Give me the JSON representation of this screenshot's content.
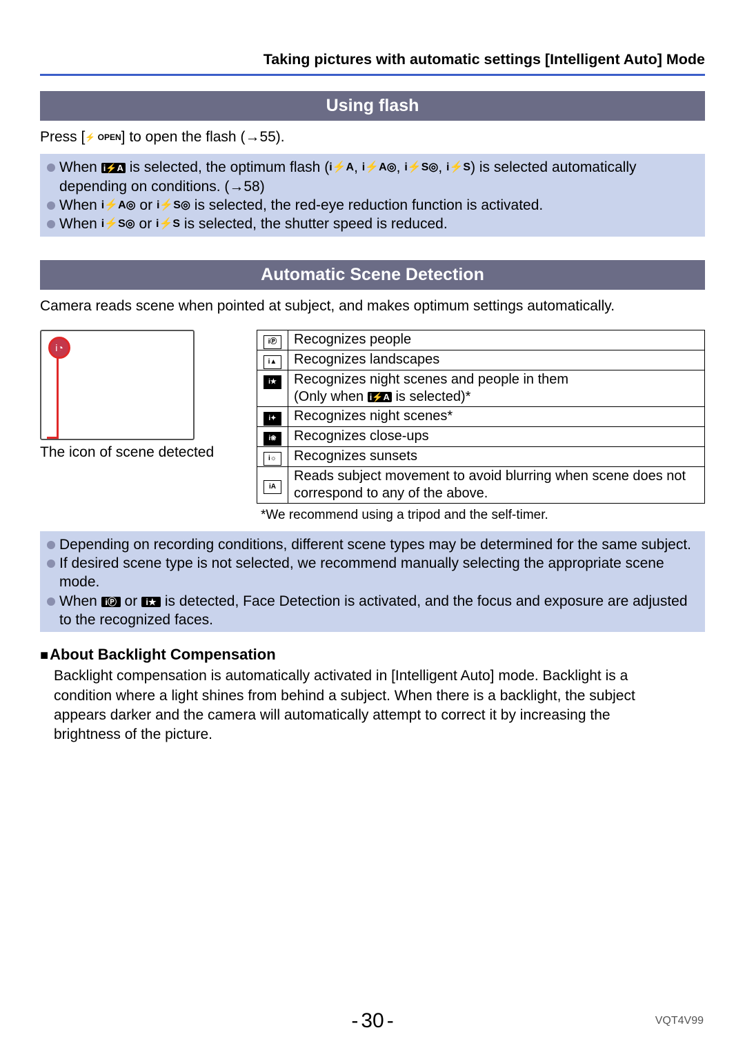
{
  "header": {
    "title": "Taking pictures with automatic settings  [Intelligent Auto] Mode"
  },
  "section1": {
    "title": "Using flash",
    "press_a": "Press [",
    "press_b": "] to open the flash (→55).",
    "open_glyph": "⚡ OPEN",
    "bullets": {
      "b1a": "When ",
      "b1_icon": "i⚡A",
      "b1b": " is selected, the optimum flash (",
      "b1_g1": "i⚡A",
      "b1_c": ", ",
      "b1_g2": "i⚡A◎",
      "b1_d": ", ",
      "b1_g3": "i⚡S◎",
      "b1_e": ", ",
      "b1_g4": "i⚡S",
      "b1f": ") is selected automatically depending on conditions. (→58)",
      "b2a": "When ",
      "b2_g1": "i⚡A◎",
      "b2b": " or ",
      "b2_g2": "i⚡S◎",
      "b2c": " is selected, the red-eye reduction function is activated.",
      "b3a": "When ",
      "b3_g1": "i⚡S◎",
      "b3b": " or ",
      "b3_g2": "i⚡S",
      "b3c": " is selected, the shutter speed is reduced."
    }
  },
  "section2": {
    "title": "Automatic Scene Detection",
    "intro": "Camera reads scene when pointed at subject, and makes optimum settings automatically.",
    "caption": "The icon of scene detected",
    "indicator_glyph": "i◔",
    "table": {
      "r1": "Recognizes people",
      "r2": "Recognizes landscapes",
      "r3a": "Recognizes night scenes and people in them",
      "r3b_a": "(Only when ",
      "r3b_icon": "i⚡A",
      "r3b_b": " is selected)*",
      "r4": "Recognizes night scenes*",
      "r5": "Recognizes close-ups",
      "r6": "Recognizes sunsets",
      "r7": "Reads subject movement to avoid blurring when scene does not correspond to any of the above.",
      "i1": "iⓅ",
      "i2": "i▲",
      "i3": "i★",
      "i4": "i✦",
      "i5": "i❀",
      "i6": "i☼",
      "i7": "iA"
    },
    "note": "*We recommend using a tripod and the self-timer.",
    "box": {
      "b1": "Depending on recording conditions, different scene types may be determined for the same subject.",
      "b2": "If desired scene type is not selected, we recommend manually selecting the appropriate scene mode.",
      "b3a": "When ",
      "b3_i1": "iⓅ",
      "b3b": " or ",
      "b3_i2": "i★",
      "b3c": " is detected, Face Detection is activated, and the focus and exposure are adjusted to the recognized faces."
    },
    "sub": {
      "title": "About Backlight Compensation",
      "text": "Backlight compensation is automatically activated in [Intelligent Auto] mode. Backlight is a condition where a light shines from behind a subject. When there is a backlight, the subject appears darker and the camera will automatically attempt to correct it by increasing the brightness of the picture."
    }
  },
  "footer": {
    "page": "30",
    "code": "VQT4V99"
  }
}
